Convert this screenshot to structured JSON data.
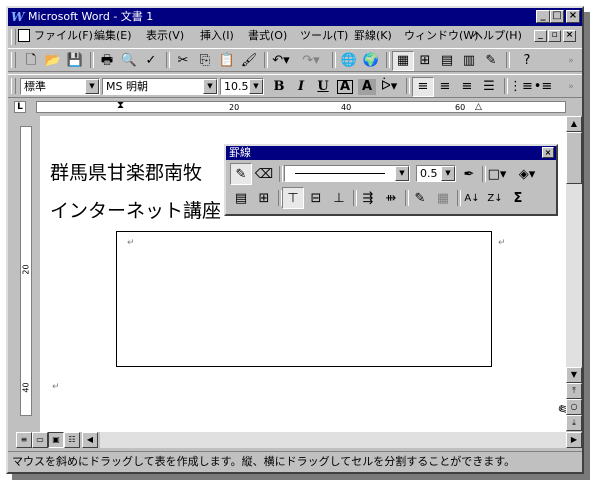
{
  "window": {
    "title": "Microsoft Word - 文書 1",
    "app_icon": "W"
  },
  "menubar": {
    "items": [
      "ファイル(F)",
      "編集(E)",
      "表示(V)",
      "挿入(I)",
      "書式(O)",
      "ツール(T)",
      "罫線(K)",
      "ウィンドウ(W)",
      "ヘルプ(H)"
    ]
  },
  "format_toolbar": {
    "style": "標準",
    "font": "MS 明朝",
    "size": "10.5",
    "bold": "B",
    "italic": "I",
    "underline": "U",
    "border_char": "A",
    "shade_char": "A"
  },
  "ruler": {
    "marks": [
      "20",
      "40",
      "60"
    ]
  },
  "vruler": {
    "marks": [
      "20",
      "40"
    ]
  },
  "document": {
    "line1": "群馬県甘楽郡南牧",
    "line2": "インターネット講座",
    "para_mark": "↵"
  },
  "tables_toolbar": {
    "title": "罫線",
    "line_weight": "0.5",
    "sum_symbol": "Σ"
  },
  "statusbar": {
    "text": "マウスを斜めにドラッグして表を作成します。縦、横にドラッグしてセルを分割することができます。"
  },
  "colors": {
    "title_bg": "#000080",
    "face": "#c0c0c0"
  }
}
